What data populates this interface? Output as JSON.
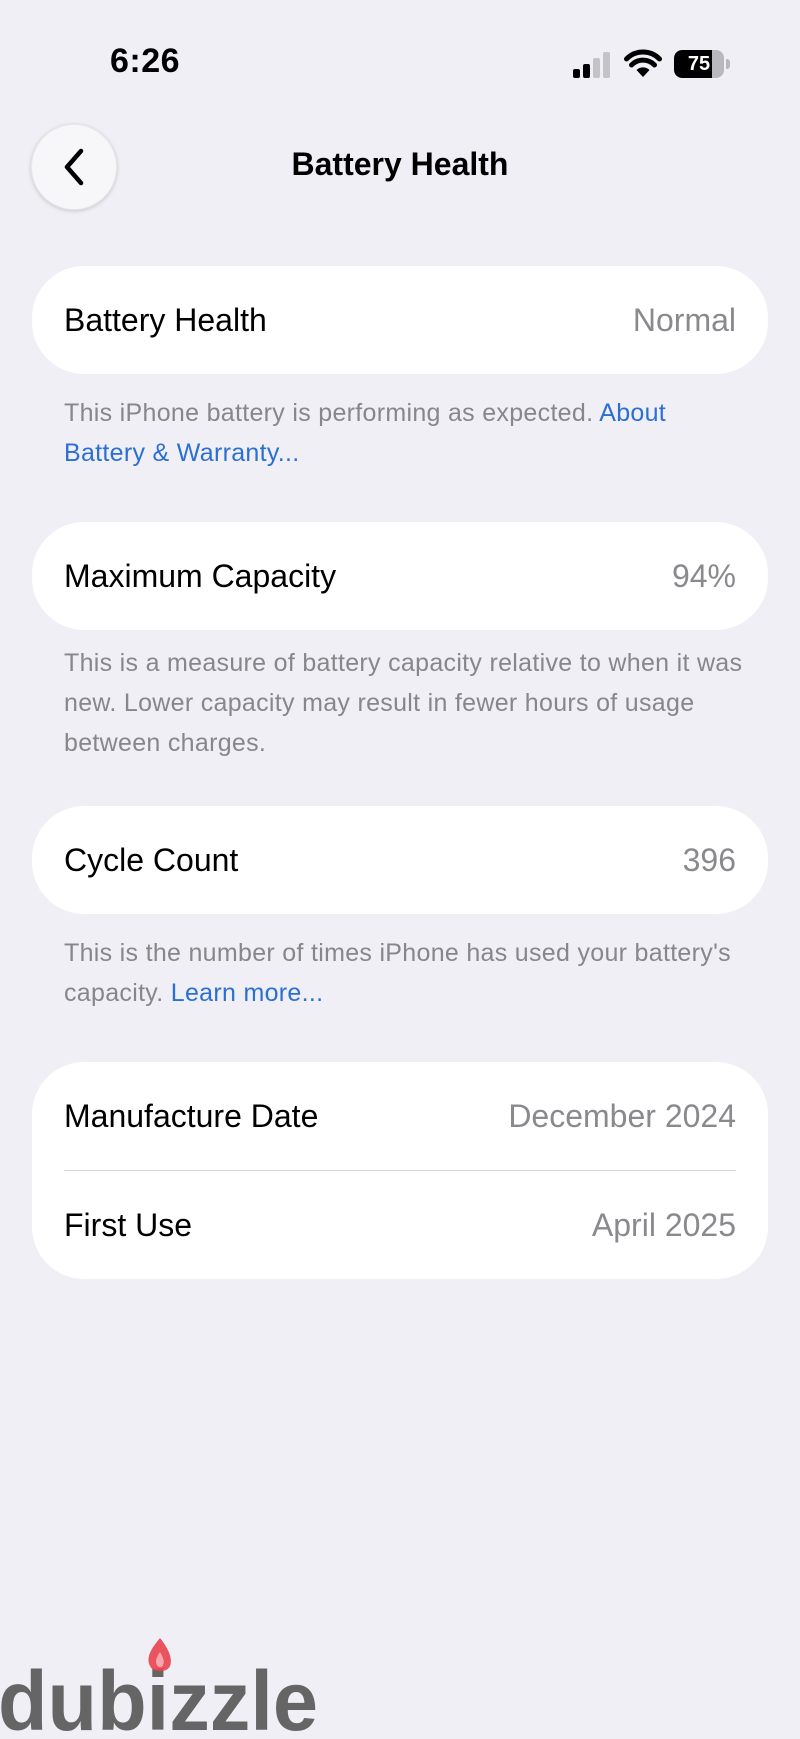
{
  "status_bar": {
    "time": "6:26",
    "battery_level": "75",
    "battery_fraction": 0.75,
    "icons": [
      "cellular-signal-icon",
      "wifi-icon",
      "battery-icon"
    ]
  },
  "nav": {
    "title": "Battery Health",
    "back_icon": "chevron-left-icon"
  },
  "battery_health": {
    "label": "Battery Health",
    "value": "Normal",
    "footnote": "This iPhone battery is performing as expected.",
    "link": "About Battery & Warranty..."
  },
  "maximum_capacity": {
    "label": "Maximum Capacity",
    "value": "94%",
    "footnote": "This is a measure of battery capacity relative to when it was new. Lower capacity may result in fewer hours of usage between charges."
  },
  "cycle_count": {
    "label": "Cycle Count",
    "value": "396",
    "footnote": "This is the number of times iPhone has used your battery's capacity.",
    "link": "Learn more..."
  },
  "dates": {
    "manufacture_label": "Manufacture Date",
    "manufacture_value": "December 2024",
    "first_use_label": "First Use",
    "first_use_value": "April 2025"
  },
  "watermark": {
    "text": "dubizzle"
  },
  "colors": {
    "background": "#f0eff5",
    "card": "#ffffff",
    "link": "#2b6fd1",
    "secondary_text": "#86868b",
    "watermark_gray": "#5a5a5a",
    "watermark_flame": "#e8434f"
  }
}
